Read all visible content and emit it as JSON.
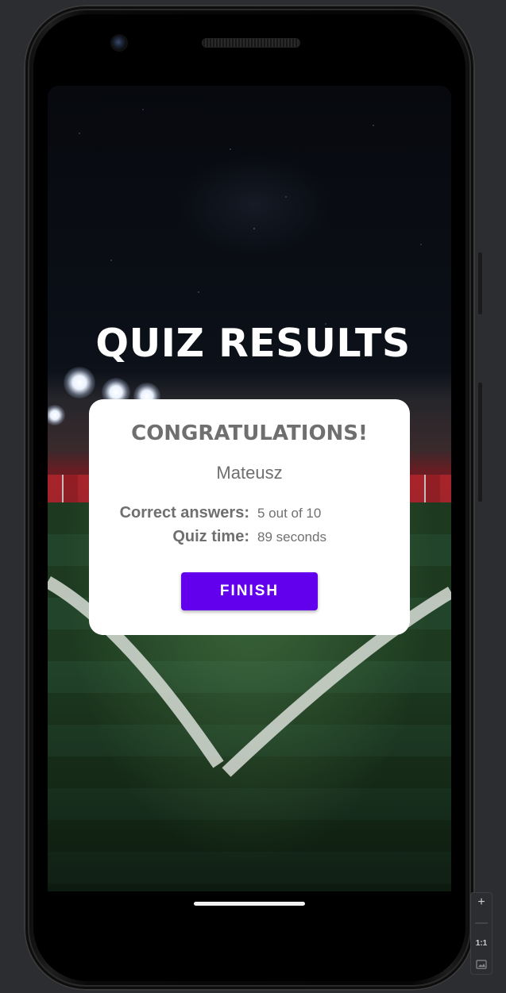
{
  "screen": {
    "title": "QUIZ RESULTS",
    "card": {
      "heading": "CONGRATULATIONS!",
      "username": "Mateusz",
      "rows": [
        {
          "label": "Correct answers:",
          "value": "5 out of 10"
        },
        {
          "label": "Quiz time:",
          "value": "89 seconds"
        }
      ],
      "finish_label": "FINISH"
    }
  },
  "emulator_controls": {
    "zoom_in": "+",
    "zoom_out": "—",
    "actual_size": "1:1"
  },
  "colors": {
    "accent": "#6200ee",
    "card_text": "#6f6f6f",
    "title_text": "#ffffff"
  }
}
